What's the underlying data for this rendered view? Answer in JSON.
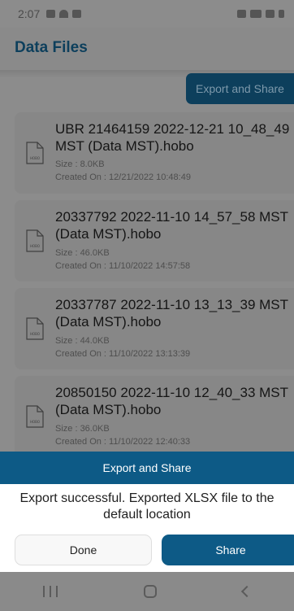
{
  "status_bar": {
    "time": "2:07"
  },
  "header": {
    "title": "Data Files"
  },
  "toolbar": {
    "export_share_label": "Export and Share"
  },
  "files": [
    {
      "name": "UBR 21464159 2022-12-21 10_48_49 MST (Data MST).hobo",
      "size": "Size : 8.0KB",
      "created": "Created On : 12/21/2022 10:48:49",
      "icon": "hobo-file-icon"
    },
    {
      "name": "20337792 2022-11-10 14_57_58 MST (Data MST).hobo",
      "size": "Size : 46.0KB",
      "created": "Created On : 11/10/2022 14:57:58",
      "icon": "hobo-file-icon"
    },
    {
      "name": "20337787 2022-11-10 13_13_39 MST (Data MST).hobo",
      "size": "Size : 44.0KB",
      "created": "Created On : 11/10/2022 13:13:39",
      "icon": "hobo-file-icon"
    },
    {
      "name": "20850150 2022-11-10 12_40_33 MST (Data MST).hobo",
      "size": "Size : 36.0KB",
      "created": "Created On : 11/10/2022 12:40:33",
      "icon": "hobo-file-icon"
    }
  ],
  "dialog": {
    "title": "Export and Share",
    "message": "Export successful. Exported XLSX file to the default location",
    "done_label": "Done",
    "share_label": "Share"
  },
  "colors": {
    "accent": "#0d5a86",
    "header_text": "#0d3f5c",
    "scrim": "#8c8c8c"
  }
}
